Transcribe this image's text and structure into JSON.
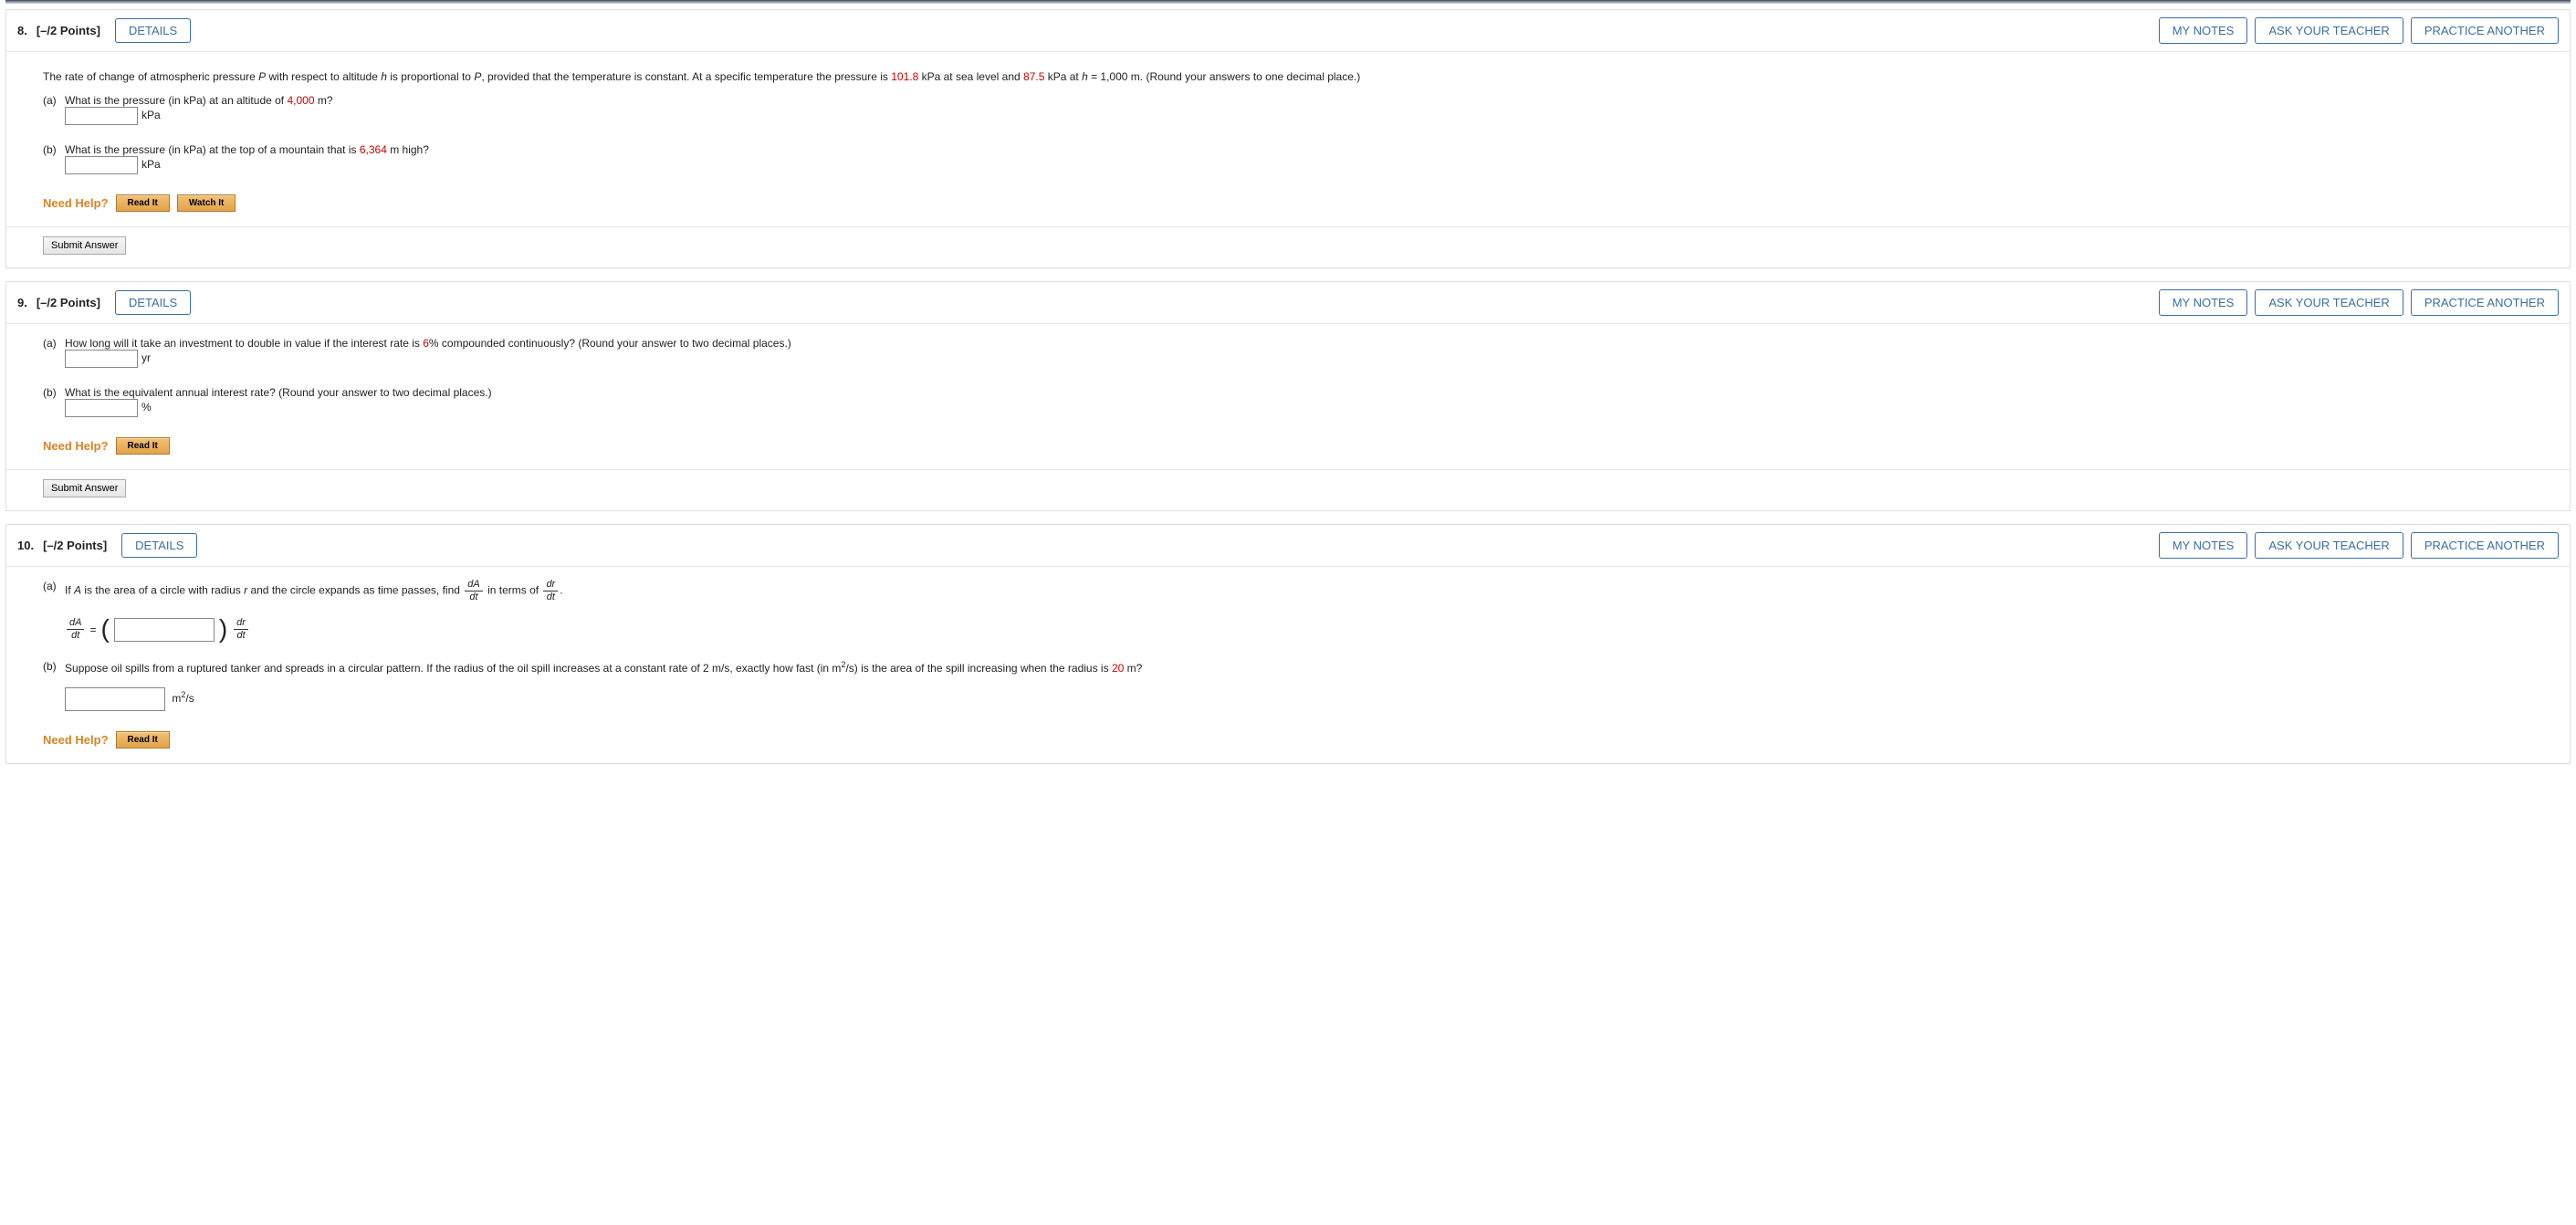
{
  "buttons": {
    "details": "DETAILS",
    "my_notes": "MY NOTES",
    "ask_teacher": "ASK YOUR TEACHER",
    "practice_another": "PRACTICE ANOTHER",
    "submit": "Submit Answer",
    "read_it": "Read It",
    "watch_it": "Watch It"
  },
  "labels": {
    "need_help": "Need Help?"
  },
  "q8": {
    "number": "8.",
    "points": "[–/2 Points]",
    "intro_a": "The rate of change of atmospheric pressure ",
    "var_P": "P",
    "intro_b": " with respect to altitude ",
    "var_h": "h",
    "intro_c": " is proportional to ",
    "intro_d": ", provided that the temperature is constant. At a specific temperature the pressure is ",
    "val_sea": "101.8",
    "intro_e": " kPa at sea level and ",
    "val_1000": "87.5",
    "intro_f": " kPa at ",
    "eqn": " = 1,000 m. (Round your answers to one decimal place.)",
    "part_a_lbl": "(a)",
    "part_a_text_a": "What is the pressure (in kPa) at an altitude of ",
    "part_a_val": "4,000",
    "part_a_text_b": " m?",
    "part_a_unit": "kPa",
    "part_b_lbl": "(b)",
    "part_b_text_a": "What is the pressure (in kPa) at the top of a mountain that is ",
    "part_b_val": "6,364",
    "part_b_text_b": " m high?",
    "part_b_unit": "kPa"
  },
  "q9": {
    "number": "9.",
    "points": "[–/2 Points]",
    "part_a_lbl": "(a)",
    "part_a_text_a": "How long will it take an investment to double in value if the interest rate is ",
    "part_a_val": "6",
    "part_a_text_b": "% compounded continuously? (Round your answer to two decimal places.)",
    "part_a_unit": "yr",
    "part_b_lbl": "(b)",
    "part_b_text": "What is the equivalent annual interest rate? (Round your answer to two decimal places.)",
    "part_b_unit": "%"
  },
  "q10": {
    "number": "10.",
    "points": "[–/2 Points]",
    "part_a_lbl": "(a)",
    "part_a_text_a": "If ",
    "var_A": "A",
    "part_a_text_b": " is the area of a circle with radius ",
    "var_r": "r",
    "part_a_text_c": " and the circle expands as time passes, find ",
    "part_a_text_d": " in terms of ",
    "period": ".",
    "dA": "dA",
    "dt": "dt",
    "dr": "dr",
    "equals": "=",
    "part_b_lbl": "(b)",
    "part_b_text_a": "Suppose oil spills from a ruptured tanker and spreads in a circular pattern. If the radius of the oil spill increases at a constant rate of 2 m/s, exactly how fast (in m",
    "sup2": "2",
    "part_b_text_b": "/s) is the area of the spill increasing when the radius is ",
    "part_b_val": "20",
    "part_b_text_c": " m?",
    "part_b_unit_a": "m",
    "part_b_unit_b": "/s"
  }
}
